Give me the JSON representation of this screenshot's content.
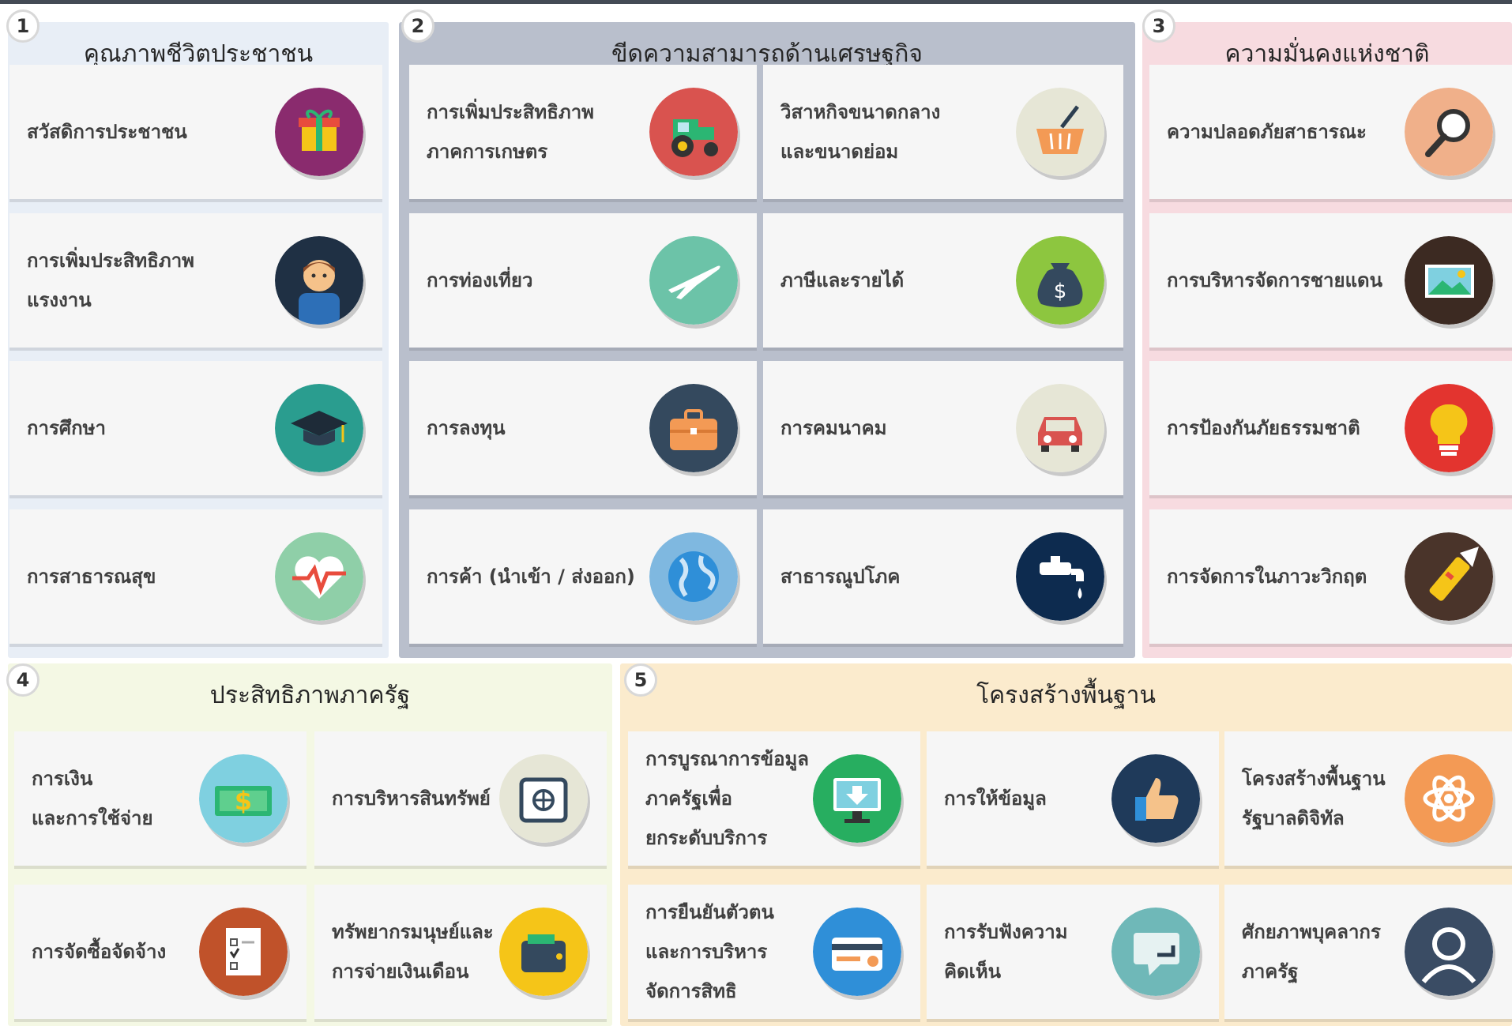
{
  "sections": [
    {
      "number": "1",
      "title": "คุณภาพชีวิตประชาชน",
      "items": [
        {
          "label": "สวัสดิการประชาชน",
          "icon": "gift-icon",
          "color": "#8a2b6e"
        },
        {
          "label": "การเพิ่มประสิทธิภาพ\nแรงงาน",
          "icon": "worker-icon",
          "color": "#1f3044"
        },
        {
          "label": "การศึกษา",
          "icon": "graduation-cap-icon",
          "color": "#2a9d8f"
        },
        {
          "label": "การสาธารณสุข",
          "icon": "heartbeat-icon",
          "color": "#8fcfa8"
        }
      ]
    },
    {
      "number": "2",
      "title": "ขีดความสามารถด้านเศรษฐกิจ",
      "items": [
        {
          "label": "การเพิ่มประสิทธิภาพ\nภาคการเกษตร",
          "icon": "tractor-icon",
          "color": "#d9534f"
        },
        {
          "label": "วิสาหกิจขนาดกลาง\nและขนาดย่อม",
          "icon": "basket-icon",
          "color": "#e6e6d6"
        },
        {
          "label": "การท่องเที่ยว",
          "icon": "airplane-icon",
          "color": "#6cc3a8"
        },
        {
          "label": "ภาษีและรายได้",
          "icon": "money-bag-icon",
          "color": "#8dc63f"
        },
        {
          "label": "การลงทุน",
          "icon": "briefcase-icon",
          "color": "#34495e"
        },
        {
          "label": "การคมนาคม",
          "icon": "car-icon",
          "color": "#e6e6d6"
        },
        {
          "label": "การค้า (นำเข้า / ส่งออก)",
          "icon": "globe-icon",
          "color": "#7fb8e0"
        },
        {
          "label": "สาธารณูปโภค",
          "icon": "water-tap-icon",
          "color": "#0d2b4f"
        }
      ]
    },
    {
      "number": "3",
      "title": "ความมั่นคงแห่งชาติ",
      "items": [
        {
          "label": "ความปลอดภัยสาธารณะ",
          "icon": "magnifier-icon",
          "color": "#f0b08a"
        },
        {
          "label": "การบริหารจัดการชายแดน",
          "icon": "landscape-icon",
          "color": "#3c2a22"
        },
        {
          "label": "การป้องกันภัยธรรมชาติ",
          "icon": "lightbulb-icon",
          "color": "#e3342f"
        },
        {
          "label": "การจัดการในภาวะวิกฤต",
          "icon": "flashlight-icon",
          "color": "#4a342a"
        }
      ]
    },
    {
      "number": "4",
      "title": "ประสิทธิภาพภาครัฐ",
      "items": [
        {
          "label": "การเงิน\nและการใช้จ่าย",
          "icon": "cash-icon",
          "color": "#7fd0e0"
        },
        {
          "label": "การบริหารสินทรัพย์",
          "icon": "safe-icon",
          "color": "#e6e6d6"
        },
        {
          "label": "การจัดซื้อจัดจ้าง",
          "icon": "checklist-icon",
          "color": "#c0522a"
        },
        {
          "label": "ทรัพยากรมนุษย์และ\nการจ่ายเงินเดือน",
          "icon": "wallet-icon",
          "color": "#f5c518"
        }
      ]
    },
    {
      "number": "5",
      "title": "โครงสร้างพื้นฐาน",
      "items": [
        {
          "label": "การบูรณาการข้อมูล\nภาครัฐเพื่อ\nยกระดับบริการ",
          "icon": "monitor-download-icon",
          "color": "#27ae60"
        },
        {
          "label": "การให้ข้อมูล",
          "icon": "thumbs-up-icon",
          "color": "#1f3a5a"
        },
        {
          "label": "โครงสร้างพื้นฐาน\nรัฐบาลดิจิทัล",
          "icon": "atom-icon",
          "color": "#f39a55"
        },
        {
          "label": "การยืนยันตัวตน\nและการบริหาร\nจัดการสิทธิ",
          "icon": "credit-card-icon",
          "color": "#2f8fd8"
        },
        {
          "label": "การรับฟังความ\nคิดเห็น",
          "icon": "speech-bubble-icon",
          "color": "#6fb8b8"
        },
        {
          "label": "ศักยภาพบุคลากร\nภาครัฐ",
          "icon": "user-profile-icon",
          "color": "#3a4c64"
        }
      ]
    }
  ]
}
